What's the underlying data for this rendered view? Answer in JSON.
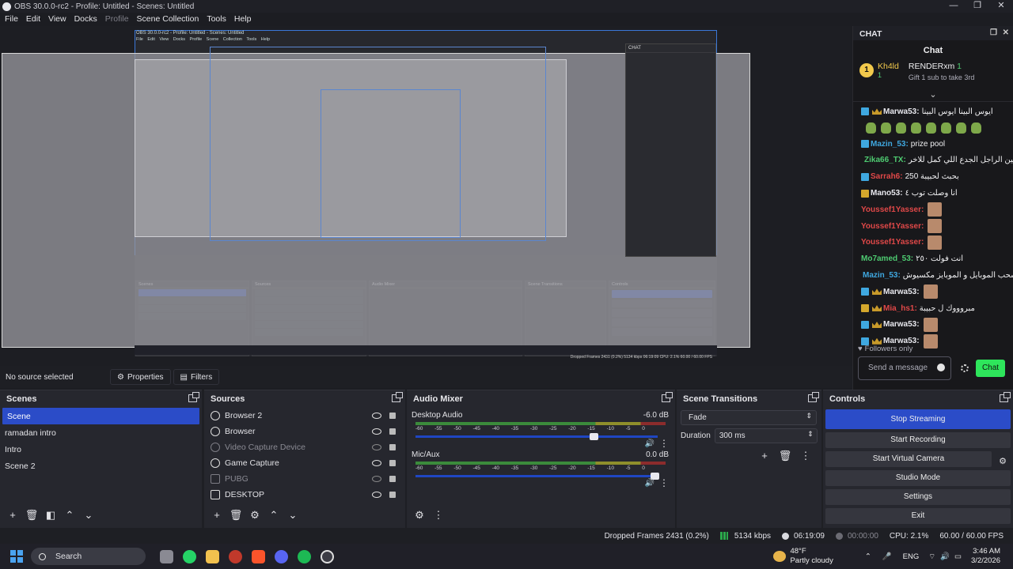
{
  "window": {
    "title": "OBS 30.0.0-rc2 - Profile: Untitled - Scenes: Untitled",
    "controls": [
      "—",
      "❐",
      "✕"
    ]
  },
  "menu": [
    "File",
    "Edit",
    "View",
    "Docks",
    "Profile",
    "Scene Collection",
    "Tools",
    "Help"
  ],
  "preview_nested": {
    "title": "OBS 30.0.0-rc2 - Profile: Untitled - Scenes: Untitled",
    "menu": "File Edit View Docks Profile Scene Collection Tools Help",
    "chat_header": "CHAT",
    "status": "Dropped Frames 2431 (0.2%)   5134 kbps   06:19:09   CPU: 2.1%   60.00 / 60.00 FPS"
  },
  "chat": {
    "dock_title": "CHAT",
    "title": "Chat",
    "pinned": {
      "rank": "1",
      "user1": "Kh4ld",
      "user1_count": "1",
      "user2": "RENDERxm",
      "user2_count": "1",
      "gift": "Gift 1 sub to take 3rd"
    },
    "messages": [
      {
        "user": "Marwa53:",
        "color": "#e8e8ee",
        "text": "ايوس البينا ايوس البينا",
        "badge": "blue",
        "crown": true,
        "emote": false
      },
      {
        "frogs": true
      },
      {
        "user": "Mazin_53:",
        "color": "#3fa8e0",
        "text": "prize pool",
        "badge": "blue",
        "crown": false,
        "emote": false
      },
      {
        "user": "Zika66_TX:",
        "color": "#4ecb71",
        "text": "فين الراجل الجدع اللي كمل للاخر",
        "badge": "blue",
        "crown": false,
        "emote": false,
        "red": true
      },
      {
        "user": "Sarrah6:",
        "color": "#e04848",
        "text": "250 بحبث لحبيبة",
        "badge": "blue",
        "crown": false,
        "emote": false
      },
      {
        "user": "Mano53:",
        "color": "#e8e8ee",
        "text": "انا وصلت توب ٤",
        "badge": "gold",
        "crown": false,
        "emote": false
      },
      {
        "user": "Youssef1Yasser:",
        "color": "#e04848",
        "text": "",
        "badge": "none",
        "crown": false,
        "emote": true
      },
      {
        "user": "Youssef1Yasser:",
        "color": "#e04848",
        "text": "",
        "badge": "none",
        "crown": false,
        "emote": true
      },
      {
        "user": "Youssef1Yasser:",
        "color": "#e04848",
        "text": "",
        "badge": "none",
        "crown": false,
        "emote": true
      },
      {
        "user": "Mo7amed_53:",
        "color": "#4ecb71",
        "text": "انت فولت ٢٥٠",
        "badge": "none",
        "crown": false,
        "emote": false
      },
      {
        "user": "Mazin_53:",
        "color": "#3fa8e0",
        "text": "سحب الموبايل و الموبايز مكسيوش",
        "badge": "blue",
        "crown": false,
        "emote": false
      },
      {
        "user": "Marwa53:",
        "color": "#e8e8ee",
        "text": "",
        "badge": "blue",
        "crown": true,
        "emote": true
      },
      {
        "user": "Mia_hs1:",
        "color": "#e04848",
        "text": "مبروووك ل حبيبة",
        "badge": "gold",
        "crown": true,
        "emote": false
      },
      {
        "user": "Marwa53:",
        "color": "#e8e8ee",
        "text": "",
        "badge": "blue",
        "crown": true,
        "emote": true
      },
      {
        "user": "Marwa53:",
        "color": "#e8e8ee",
        "text": "",
        "badge": "blue",
        "crown": true,
        "emote": true
      }
    ],
    "followers": "Followers only",
    "placeholder": "Send a message",
    "chat_button": "Chat"
  },
  "source_bar": {
    "no_source": "No source selected",
    "properties": "Properties",
    "filters": "Filters"
  },
  "scenes": {
    "title": "Scenes",
    "items": [
      "Scene",
      "ramadan intro",
      "Intro",
      "Scene 2"
    ],
    "selected": 0
  },
  "sources": {
    "title": "Sources",
    "items": [
      {
        "name": "Browser 2",
        "icon": "globe-icon",
        "visible": true,
        "dim": false
      },
      {
        "name": "Browser",
        "icon": "globe-icon",
        "visible": true,
        "dim": false
      },
      {
        "name": "Video Capture Device",
        "icon": "camera-icon",
        "visible": false,
        "dim": true
      },
      {
        "name": "Game Capture",
        "icon": "gamepad-icon",
        "visible": true,
        "dim": false
      },
      {
        "name": "PUBG",
        "icon": "window-icon",
        "visible": false,
        "dim": true
      },
      {
        "name": "DESKTOP",
        "icon": "monitor-icon",
        "visible": true,
        "dim": false
      }
    ]
  },
  "audio": {
    "title": "Audio Mixer",
    "ticks": [
      "-60",
      "-55",
      "-50",
      "-45",
      "-40",
      "-35",
      "-30",
      "-25",
      "-20",
      "-15",
      "-10",
      "-5",
      "0"
    ],
    "channels": [
      {
        "name": "Desktop Audio",
        "db": "-6.0 dB",
        "volume": 0.72
      },
      {
        "name": "Mic/Aux",
        "db": "0.0 dB",
        "volume": 0.97
      }
    ]
  },
  "transitions": {
    "title": "Scene Transitions",
    "selected": "Fade",
    "duration_label": "Duration",
    "duration": "300 ms"
  },
  "controls": {
    "title": "Controls",
    "buttons": [
      "Stop Streaming",
      "Start Recording",
      "Start Virtual Camera",
      "Studio Mode",
      "Settings",
      "Exit"
    ]
  },
  "status": {
    "dropped": "Dropped Frames 2431 (0.2%)",
    "kbps": "5134 kbps",
    "stream_time": "06:19:09",
    "rec_time": "00:00:00",
    "cpu": "CPU: 2.1%",
    "fps": "60.00 / 60.00 FPS"
  },
  "taskbar": {
    "search": "Search",
    "weather_temp": "48°F",
    "weather_desc": "Partly cloudy",
    "lang": "ENG",
    "time": "3:46 AM",
    "date": "3/2/2026"
  },
  "colors": {
    "accent": "#2b4cc8",
    "chat_green": "#2ee55b",
    "preview_border": "#3b78d8"
  }
}
